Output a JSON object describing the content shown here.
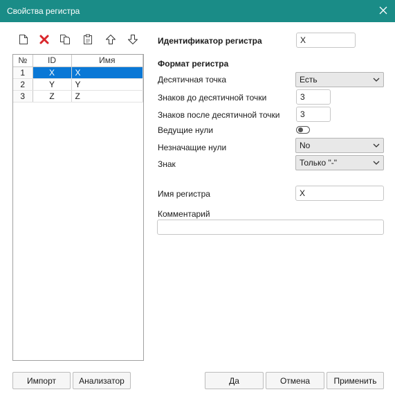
{
  "window": {
    "title": "Свойства регистра",
    "titlebar_color": "#1a8c87"
  },
  "toolbar": {
    "icons": [
      "new-file-icon",
      "delete-icon",
      "copy-icon",
      "paste-icon",
      "move-up-icon",
      "move-down-icon"
    ]
  },
  "grid": {
    "columns": [
      "№",
      "ID",
      "Имя"
    ],
    "rows": [
      {
        "num": "1",
        "id": "X",
        "name": "X",
        "selected": true
      },
      {
        "num": "2",
        "id": "Y",
        "name": "Y",
        "selected": false
      },
      {
        "num": "3",
        "id": "Z",
        "name": "Z",
        "selected": false
      }
    ],
    "selection_color": "#0a78d6"
  },
  "form": {
    "identifier_label": "Идентификатор регистра",
    "identifier_value": "X",
    "format_heading": "Формат регистра",
    "decimal_point_label": "Десятичная точка",
    "decimal_point_value": "Есть",
    "digits_before_label": "Знаков до десятичной точки",
    "digits_before_value": "3",
    "digits_after_label": "Знаков после десятичной точки",
    "digits_after_value": "3",
    "leading_zeros_label": "Ведущие нули",
    "leading_zeros_on": false,
    "trailing_zeros_label": "Незначащие нули",
    "trailing_zeros_value": "No",
    "sign_label": "Знак",
    "sign_value": "Только \"-\"",
    "register_name_label": "Имя регистра",
    "register_name_value": "X",
    "comment_label": "Комментарий",
    "comment_value": ""
  },
  "buttons": {
    "import": "Импорт",
    "analyzer": "Анализатор",
    "ok": "Да",
    "cancel": "Отмена",
    "apply": "Применить"
  }
}
